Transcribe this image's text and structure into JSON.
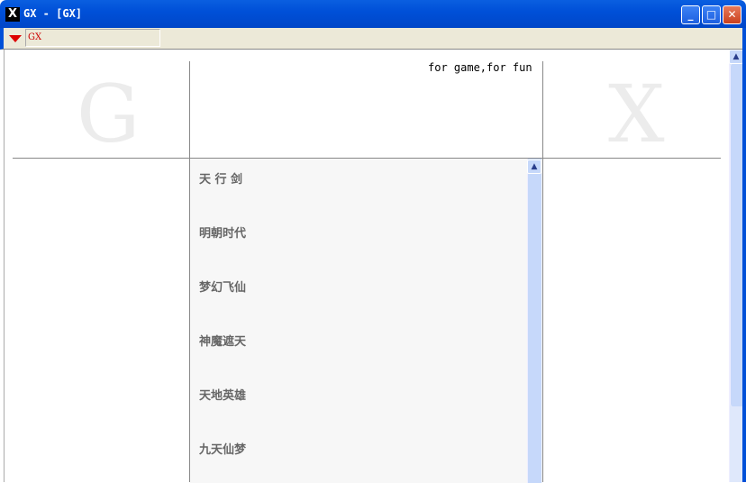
{
  "window": {
    "title": "GX - [GX]",
    "icon": "x-logo-icon",
    "controls": [
      "minimize",
      "maximize",
      "close"
    ]
  },
  "toolbar": {
    "address": "GX"
  },
  "header": {
    "left_letter": "G",
    "right_letter": "X",
    "tagline": "for game,for fun"
  },
  "list": {
    "items": [
      "天 行 剑",
      "明朝时代",
      "梦幻飞仙",
      "神魔遮天",
      "天地英雄",
      "九天仙梦"
    ]
  }
}
